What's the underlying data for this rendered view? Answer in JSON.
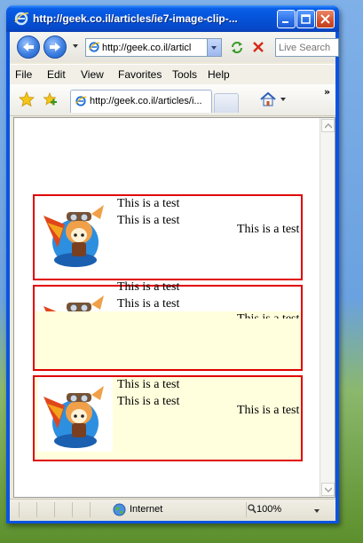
{
  "window": {
    "title": "http://geek.co.il/articles/ie7-image-clip-..."
  },
  "toolbar": {
    "address": "http://geek.co.il/articl",
    "search_placeholder": "Live Search"
  },
  "menu": [
    "File",
    "Edit",
    "View",
    "Favorites",
    "Tools",
    "Help"
  ],
  "tab": {
    "label": "http://geek.co.il/articles/i...",
    "chevron": "»"
  },
  "page": {
    "boxes": [
      {
        "line1": "This is a test",
        "line2": "This is a test",
        "side": "This is a test"
      },
      {
        "line1": "This is a test",
        "line2": "This is a test",
        "side": "This is a test"
      },
      {
        "line1": "This is a test",
        "line2": "This is a test",
        "side": "This is a test"
      }
    ]
  },
  "status": {
    "zone": "Internet",
    "zoom": "100%"
  },
  "colors": {
    "box_border": "#e00000",
    "box_fill": "#ffffdd",
    "title_bar": "#0553d8"
  }
}
